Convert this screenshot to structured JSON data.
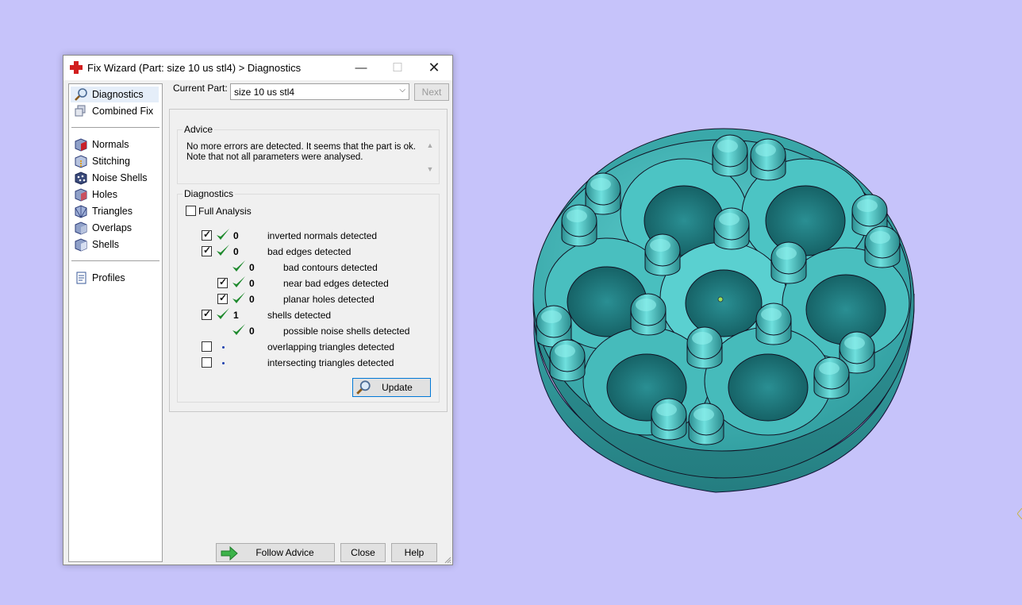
{
  "window": {
    "title": "Fix Wizard (Part: size 10 us stl4) > Diagnostics",
    "min_glyph": "—",
    "max_glyph": "☐",
    "close_glyph": "✕"
  },
  "sidebar": {
    "items": [
      {
        "label": "Diagnostics",
        "icon": "magnifier-icon",
        "selected": true
      },
      {
        "label": "Combined Fix",
        "icon": "cube-stack-icon"
      },
      {
        "label": "Normals",
        "icon": "normals-cube-icon"
      },
      {
        "label": "Stitching",
        "icon": "stitching-cube-icon"
      },
      {
        "label": "Noise Shells",
        "icon": "noise-shells-icon"
      },
      {
        "label": "Holes",
        "icon": "holes-cube-icon"
      },
      {
        "label": "Triangles",
        "icon": "triangles-cube-icon"
      },
      {
        "label": "Overlaps",
        "icon": "overlaps-cube-icon"
      },
      {
        "label": "Shells",
        "icon": "shells-cube-icon"
      },
      {
        "label": "Profiles",
        "icon": "document-icon"
      }
    ]
  },
  "header": {
    "current_part_label": "Current Part:",
    "current_part_value": "size 10 us stl4",
    "next_label": "Next"
  },
  "advice": {
    "title": "Advice",
    "text": "No more errors are detected. It seems that the part is ok. Note that not all parameters were analysed."
  },
  "diagnostics": {
    "title": "Diagnostics",
    "full_analysis_label": "Full Analysis",
    "full_analysis_checked": false,
    "rows": [
      {
        "checkbox": true,
        "checked": true,
        "status": "ok",
        "count": "0",
        "label": "inverted normals detected",
        "indent": 0
      },
      {
        "checkbox": true,
        "checked": true,
        "status": "ok",
        "count": "0",
        "label": "bad edges detected",
        "indent": 0
      },
      {
        "checkbox": false,
        "checked": false,
        "status": "ok",
        "count": "0",
        "label": "bad contours detected",
        "indent": 1
      },
      {
        "checkbox": true,
        "checked": true,
        "status": "ok",
        "count": "0",
        "label": "near bad edges detected",
        "indent": 1
      },
      {
        "checkbox": true,
        "checked": true,
        "status": "ok",
        "count": "0",
        "label": "planar holes detected",
        "indent": 1
      },
      {
        "checkbox": true,
        "checked": true,
        "status": "ok",
        "count": "1",
        "label": "shells detected",
        "indent": 0
      },
      {
        "checkbox": false,
        "checked": false,
        "status": "ok",
        "count": "0",
        "label": "possible noise shells detected",
        "indent": 1
      },
      {
        "checkbox": true,
        "checked": false,
        "status": "none",
        "count": "",
        "label": "overlapping triangles detected",
        "indent": 0
      },
      {
        "checkbox": true,
        "checked": false,
        "status": "none",
        "count": "",
        "label": "intersecting triangles detected",
        "indent": 0
      }
    ],
    "update_label": "Update"
  },
  "footer": {
    "follow_advice_label": "Follow Advice",
    "close_label": "Close",
    "help_label": "Help"
  },
  "colors": {
    "desktop_bg": "#c6c3fa",
    "model_teal": "#3fb8b8",
    "check_green": "#1f8a2e"
  }
}
